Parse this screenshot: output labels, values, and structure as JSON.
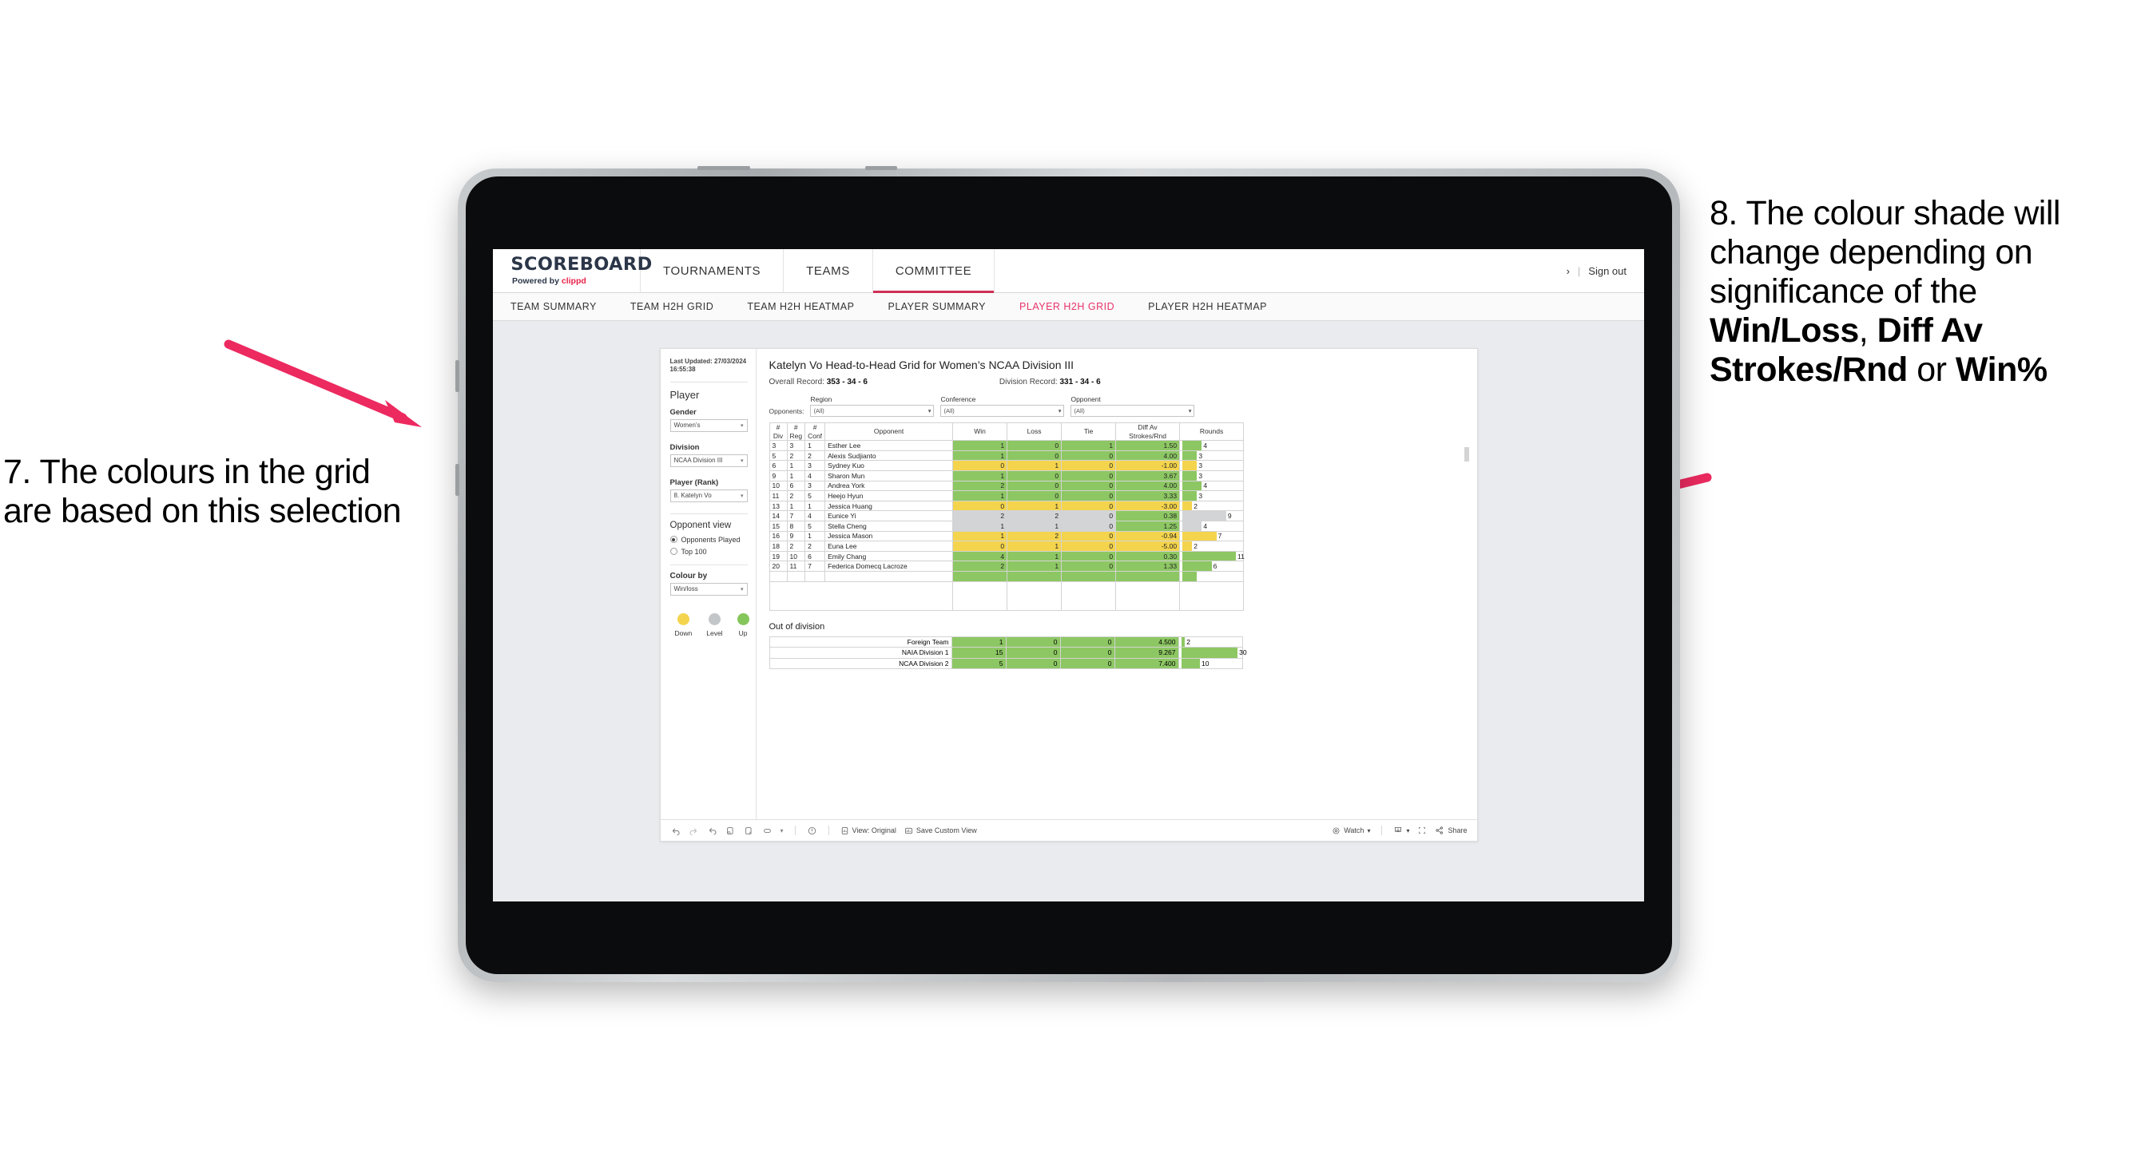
{
  "annotations": {
    "left": {
      "id": "7.",
      "text": "7. The colours in the grid are based on this selection"
    },
    "right": {
      "id": "8.",
      "pre": "8. The colour shade will change depending on significance of the ",
      "bold1": "Win/Loss",
      "mid1": ", ",
      "bold2": "Diff Av Strokes/Rnd",
      "mid2": " or ",
      "bold3": "Win%"
    },
    "arrow_color": "#ec2a60"
  },
  "app": {
    "brand": {
      "title": "SCOREBOARD",
      "powered_prefix": "Powered by ",
      "powered_brand": "clippd"
    },
    "nav": [
      {
        "label": "TOURNAMENTS",
        "active": false
      },
      {
        "label": "TEAMS",
        "active": false
      },
      {
        "label": "COMMITTEE",
        "active": true
      }
    ],
    "header_right": {
      "chevron": "›",
      "divider": "|",
      "sign_out": "Sign out"
    },
    "subnav": [
      {
        "label": "TEAM SUMMARY",
        "active": false
      },
      {
        "label": "TEAM H2H GRID",
        "active": false
      },
      {
        "label": "TEAM H2H HEATMAP",
        "active": false
      },
      {
        "label": "PLAYER SUMMARY",
        "active": false
      },
      {
        "label": "PLAYER H2H GRID",
        "active": true
      },
      {
        "label": "PLAYER H2H HEATMAP",
        "active": false
      }
    ],
    "accent": "#e8336b",
    "tab_accent": "#cf2e55"
  },
  "sidebar": {
    "last_updated": "Last Updated: 27/03/2024 16:55:38",
    "section_player": "Player",
    "fields": [
      {
        "label": "Gender",
        "value": "Women’s"
      },
      {
        "label": "Division",
        "value": "NCAA Division III"
      },
      {
        "label": "Player (Rank)",
        "value": "8. Katelyn Vo"
      }
    ],
    "opponent_view": {
      "title": "Opponent view",
      "options": [
        {
          "label": "Opponents Played",
          "selected": true
        },
        {
          "label": "Top 100",
          "selected": false
        }
      ]
    },
    "colour_by": {
      "label": "Colour by",
      "value": "Win/loss"
    },
    "legend": [
      {
        "label": "Down",
        "color": "#f4d44d"
      },
      {
        "label": "Level",
        "color": "#c3c6c9"
      },
      {
        "label": "Up",
        "color": "#85c65b"
      }
    ]
  },
  "main": {
    "title": "Katelyn Vo Head-to-Head Grid for Women’s NCAA Division III",
    "overall_record_label": "Overall Record: ",
    "overall_record_value": "353 -  34 - 6",
    "division_record_label": "Division Record: ",
    "division_record_value": "331 -  34 - 6",
    "opponents_label": "Opponents:",
    "filters": [
      {
        "label": "Region",
        "value": "(All)"
      },
      {
        "label": "Conference",
        "value": "(All)"
      },
      {
        "label": "Opponent",
        "value": "(All)"
      }
    ],
    "columns": [
      {
        "l1": "#",
        "l2": "Div"
      },
      {
        "l1": "#",
        "l2": "Reg"
      },
      {
        "l1": "#",
        "l2": "Conf"
      },
      {
        "l1": "Opponent",
        "l2": ""
      },
      {
        "l1": "Win",
        "l2": ""
      },
      {
        "l1": "Loss",
        "l2": ""
      },
      {
        "l1": "Tie",
        "l2": ""
      },
      {
        "l1": "Diff Av",
        "l2": "Strokes/Rnd"
      },
      {
        "l1": "Rounds",
        "l2": ""
      }
    ],
    "rows": [
      {
        "div": "3",
        "reg": "3",
        "conf": "1",
        "opponent": "Esther Lee",
        "win": "1",
        "loss": "0",
        "tie": "1",
        "diff": "1.50",
        "rounds": 4,
        "color": "#8dc763"
      },
      {
        "div": "5",
        "reg": "2",
        "conf": "2",
        "opponent": "Alexis Sudjianto",
        "win": "1",
        "loss": "0",
        "tie": "0",
        "diff": "4.00",
        "rounds": 3,
        "color": "#8dc763"
      },
      {
        "div": "6",
        "reg": "1",
        "conf": "3",
        "opponent": "Sydney Kuo",
        "win": "0",
        "loss": "1",
        "tie": "0",
        "diff": "-1.00",
        "rounds": 3,
        "color": "#f4d44d"
      },
      {
        "div": "9",
        "reg": "1",
        "conf": "4",
        "opponent": "Sharon Mun",
        "win": "1",
        "loss": "0",
        "tie": "0",
        "diff": "3.67",
        "rounds": 3,
        "color": "#8dc763"
      },
      {
        "div": "10",
        "reg": "6",
        "conf": "3",
        "opponent": "Andrea York",
        "win": "2",
        "loss": "0",
        "tie": "0",
        "diff": "4.00",
        "rounds": 4,
        "color": "#8dc763"
      },
      {
        "div": "11",
        "reg": "2",
        "conf": "5",
        "opponent": "Heejo Hyun",
        "win": "1",
        "loss": "0",
        "tie": "0",
        "diff": "3.33",
        "rounds": 3,
        "color": "#8dc763"
      },
      {
        "div": "13",
        "reg": "1",
        "conf": "1",
        "opponent": "Jessica Huang",
        "win": "0",
        "loss": "1",
        "tie": "0",
        "diff": "-3.00",
        "rounds": 2,
        "color": "#f4d44d"
      },
      {
        "div": "14",
        "reg": "7",
        "conf": "4",
        "opponent": "Eunice Yi",
        "win": "2",
        "loss": "2",
        "tie": "0",
        "diff": "0.38",
        "rounds": 9,
        "color": "#d2d4d6",
        "diff_color": "#8dc763"
      },
      {
        "div": "15",
        "reg": "8",
        "conf": "5",
        "opponent": "Stella Cheng",
        "win": "1",
        "loss": "1",
        "tie": "0",
        "diff": "1.25",
        "rounds": 4,
        "color": "#d2d4d6",
        "diff_color": "#8dc763"
      },
      {
        "div": "16",
        "reg": "9",
        "conf": "1",
        "opponent": "Jessica Mason",
        "win": "1",
        "loss": "2",
        "tie": "0",
        "diff": "-0.94",
        "rounds": 7,
        "color": "#f4d44d"
      },
      {
        "div": "18",
        "reg": "2",
        "conf": "2",
        "opponent": "Euna Lee",
        "win": "0",
        "loss": "1",
        "tie": "0",
        "diff": "-5.00",
        "rounds": 2,
        "color": "#f4d44d"
      },
      {
        "div": "19",
        "reg": "10",
        "conf": "6",
        "opponent": "Emily Chang",
        "win": "4",
        "loss": "1",
        "tie": "0",
        "diff": "0.30",
        "rounds": 11,
        "color": "#8dc763"
      },
      {
        "div": "20",
        "reg": "11",
        "conf": "7",
        "opponent": "Federica Domecq Lacroze",
        "win": "2",
        "loss": "1",
        "tie": "0",
        "diff": "1.33",
        "rounds": 6,
        "color": "#8dc763"
      }
    ],
    "rounds_max": 12,
    "out_of_division": {
      "title": "Out of division",
      "rows": [
        {
          "name": "Foreign Team",
          "win": "1",
          "loss": "0",
          "tie": "0",
          "diff": "4.500",
          "rounds": 2,
          "color": "#8dc763"
        },
        {
          "name": "NAIA Division 1",
          "win": "15",
          "loss": "0",
          "tie": "0",
          "diff": "9.267",
          "rounds": 30,
          "color": "#8dc763"
        },
        {
          "name": "NCAA Division 2",
          "win": "5",
          "loss": "0",
          "tie": "0",
          "diff": "7.400",
          "rounds": 10,
          "color": "#8dc763"
        }
      ],
      "rounds_max": 31
    }
  },
  "toolbar": {
    "icons": [
      "undo-icon",
      "redo-icon",
      "revert-icon",
      "refresh-icon",
      "pause-icon",
      "shape-icon",
      "chevron-down-icon"
    ],
    "alert_icon": "alert-icon",
    "view_label": "View: Original",
    "save_label": "Save Custom View",
    "watch_label": "Watch",
    "download_label": "download-icon",
    "fullscreen_label": "fullscreen-icon",
    "share_label": "Share"
  }
}
